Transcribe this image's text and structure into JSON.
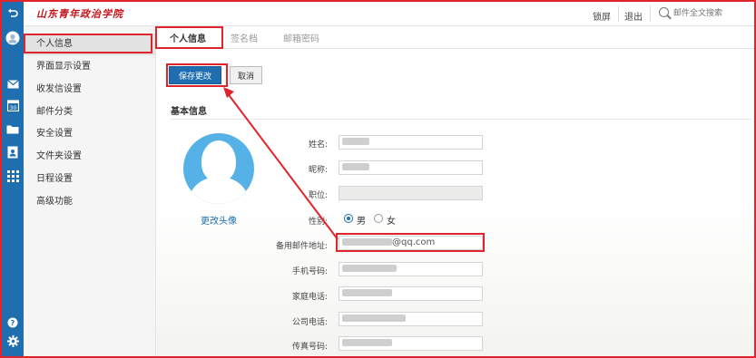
{
  "header": {
    "logo_text": "山东青年政治学院",
    "lock_label": "锁屏",
    "logout_label": "退出",
    "search_placeholder": "邮件全文搜索"
  },
  "sidebar": {
    "items": [
      {
        "label": "个人信息",
        "active": true
      },
      {
        "label": "界面显示设置"
      },
      {
        "label": "收发信设置"
      },
      {
        "label": "邮件分类"
      },
      {
        "label": "安全设置"
      },
      {
        "label": "文件夹设置"
      },
      {
        "label": "日程设置"
      },
      {
        "label": "高级功能"
      }
    ]
  },
  "tabs": [
    {
      "label": "个人信息",
      "active": true
    },
    {
      "label": "签名档"
    },
    {
      "label": "邮箱密码"
    }
  ],
  "toolbar": {
    "save_label": "保存更改",
    "cancel_label": "取消"
  },
  "basic_info": {
    "title": "基本信息",
    "change_avatar_label": "更改头像",
    "fields": {
      "name_label": "姓名:",
      "nickname_label": "昵称:",
      "position_label": "职位:",
      "gender_label": "性别:",
      "gender_male": "男",
      "gender_female": "女",
      "gender_selected": "男",
      "backup_email_label": "备用邮件地址:",
      "backup_email_suffix": "@qq.com",
      "mobile_label": "手机号码:",
      "home_phone_label": "家庭电话:",
      "office_phone_label": "公司电话:",
      "fax_label": "传真号码:"
    }
  },
  "colors": {
    "accent": "#1f6fb0",
    "annotation": "#e0242b",
    "brand": "#c4121b"
  }
}
